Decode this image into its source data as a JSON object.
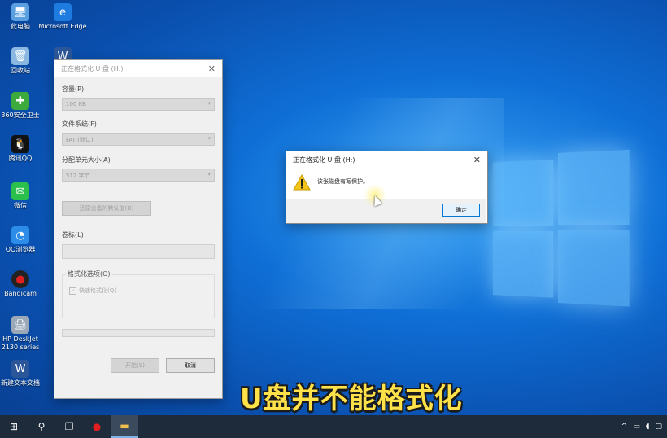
{
  "desktop_icons": [
    {
      "name": "此电脑",
      "glyph": "🖥",
      "color": "#5aa0e0"
    },
    {
      "name": "Microsoft Edge",
      "glyph": "e",
      "color": "#1e7be0"
    },
    {
      "name": "回收站",
      "glyph": "🗑",
      "color": "#8ab8e0"
    },
    {
      "name": "W",
      "glyph": "W",
      "color": "#2b579a"
    },
    {
      "name": "360安全卫士",
      "glyph": "✚",
      "color": "#3caa3c"
    },
    {
      "name": "腾讯QQ",
      "glyph": "🐧",
      "color": "#111111"
    },
    {
      "name": "微信",
      "glyph": "✉",
      "color": "#2bbf4c"
    },
    {
      "name": "QQ浏览器",
      "glyph": "◔",
      "color": "#2c8de8"
    },
    {
      "name": "Bandicam",
      "glyph": "●",
      "color": "#e02020"
    },
    {
      "name": "HP DeskJet 2130 series",
      "glyph": "🖨",
      "color": "#9aa8b8"
    },
    {
      "name": "新建文本文档",
      "glyph": "W",
      "color": "#2b579a"
    }
  ],
  "format_dialog": {
    "title": "正在格式化 U 盘 (H:)",
    "capacity_label": "容量(P):",
    "capacity_value": "100 KB",
    "filesystem_label": "文件系统(F)",
    "filesystem_value": "FAT (默认)",
    "alloc_label": "分配单元大小(A)",
    "alloc_value": "512 字节",
    "restore_defaults": "还原设备的默认值(D)",
    "volume_label": "卷标(L)",
    "options_title": "格式化选项(O)",
    "quick_format": "快速格式化(Q)",
    "start_button": "开始(S)",
    "cancel_button": "取消"
  },
  "warning_dialog": {
    "title": "正在格式化 U 盘 (H:)",
    "message": "该张磁盘有写保护。",
    "ok_button": "确定"
  },
  "caption": "U盘并不能格式化",
  "taskbar": {
    "start": "⊞",
    "search": "⚲",
    "taskview": "❐",
    "record": "●",
    "explorer": "▬"
  },
  "tray": {
    "chevron": "^"
  }
}
